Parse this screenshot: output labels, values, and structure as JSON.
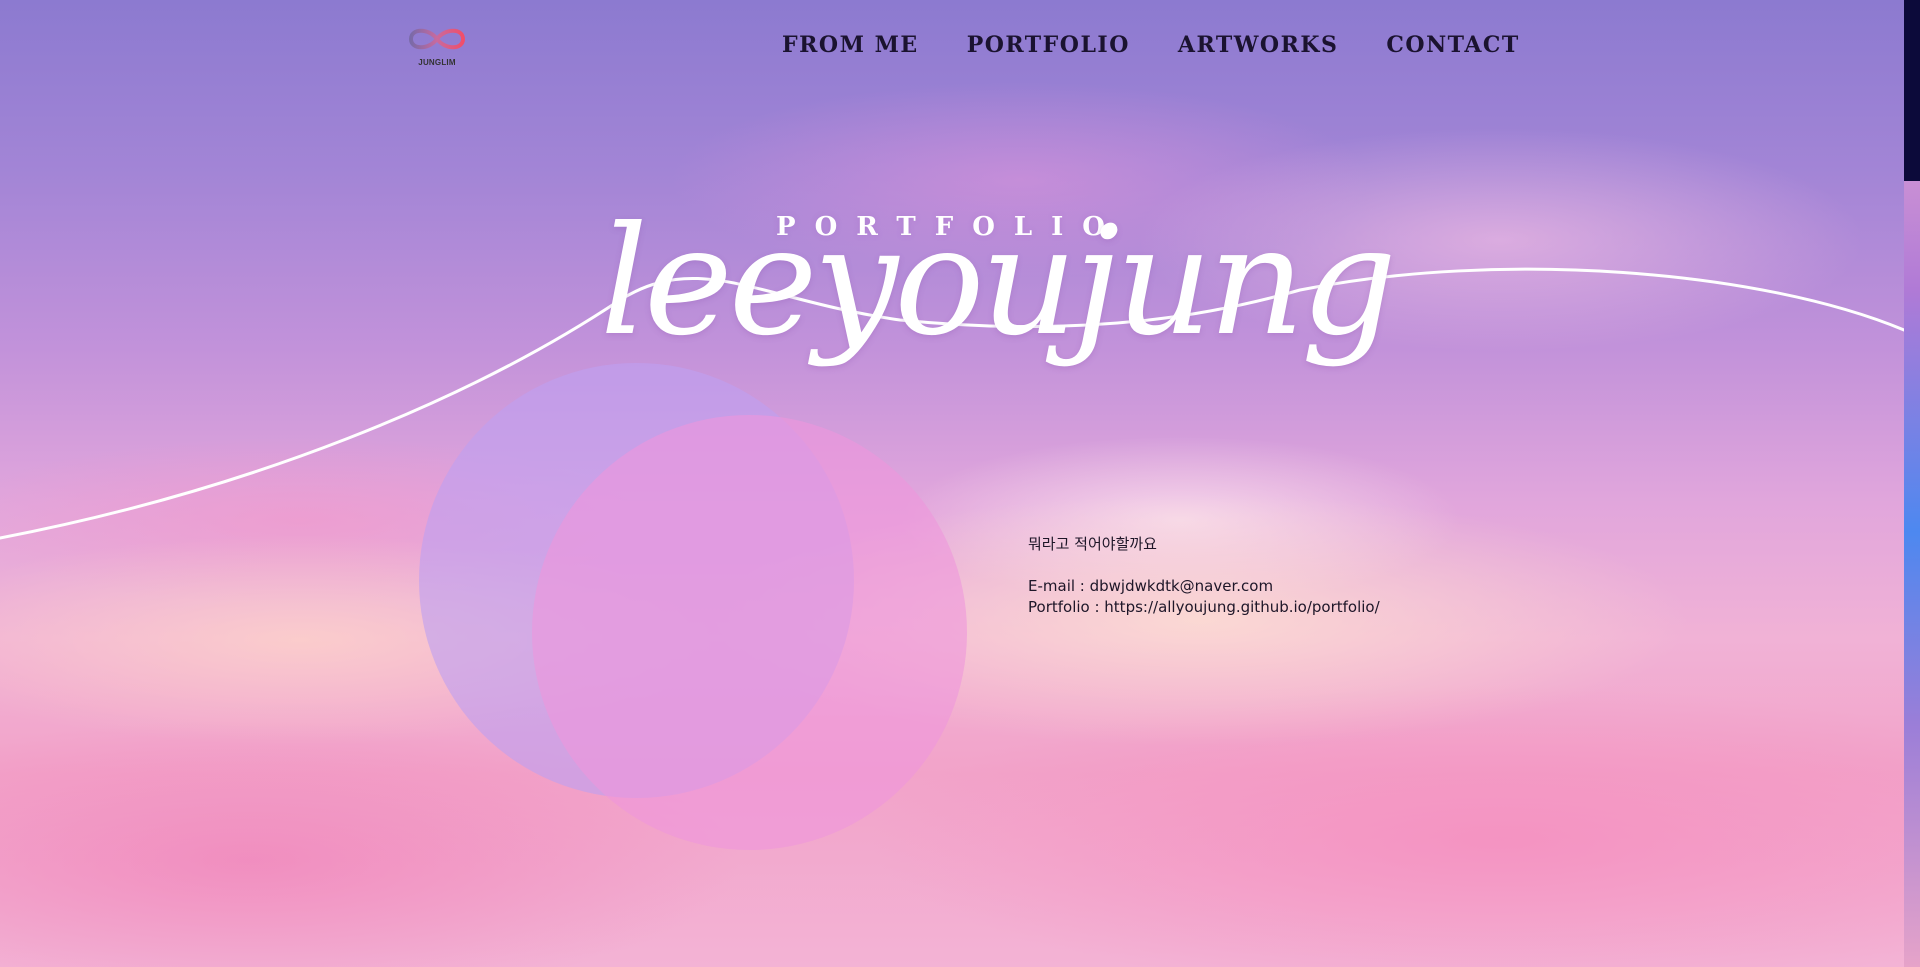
{
  "header": {
    "logo_text": "JUNGLIM",
    "nav": [
      {
        "label": "FROM ME"
      },
      {
        "label": "PORTFOLIO"
      },
      {
        "label": "ARTWORKS"
      },
      {
        "label": "CONTACT"
      }
    ]
  },
  "hero": {
    "subtitle": "PORTFOLIO",
    "title": "leeyoujung"
  },
  "info": {
    "intro": "뭐라고 적어야할까요",
    "email_line": "E-mail : dbwjdwkdtk@naver.com",
    "portfolio_line": "Portfolio : https://allyoujung.github.io/portfolio/"
  },
  "colors": {
    "nav_text": "#1b1330",
    "hero_text": "#ffffff",
    "circle_lavender": "#bea0f0",
    "circle_pink": "#ee96dc",
    "scroll_thumb": "#0c0a3a"
  },
  "icons": {
    "logo": "infinity-logo-icon"
  }
}
